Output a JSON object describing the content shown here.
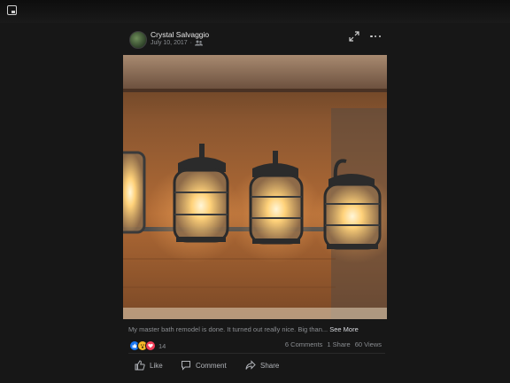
{
  "post": {
    "author": "Crystal Salvaggio",
    "date": "July 10, 2017",
    "separator": "·",
    "audience_icon": "friends-icon",
    "caption": "My master bath remodel is done. It turned out really nice. Big than...",
    "see_more": "See More"
  },
  "reactions": {
    "icons": [
      "like-reaction-icon",
      "wow-reaction-icon",
      "love-reaction-icon"
    ],
    "count": "14"
  },
  "stats": {
    "comments": "6 Comments",
    "shares": "1 Share",
    "views": "60 Views"
  },
  "actions": {
    "like": "Like",
    "comment": "Comment",
    "share": "Share"
  },
  "colors": {
    "background": "#171717",
    "like_blue": "#1877f2",
    "wow_yellow": "#f7b928",
    "love_red": "#f33e58",
    "muted_text": "#8a8d91"
  }
}
